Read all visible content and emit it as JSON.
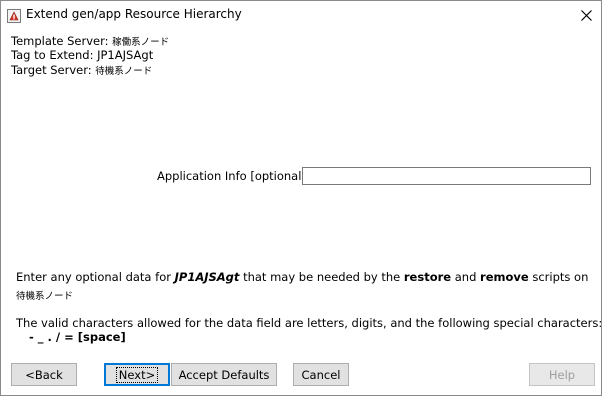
{
  "window": {
    "title": "Extend gen/app Resource Hierarchy",
    "close_glyph": "✕"
  },
  "info": {
    "template_label": "Template Server:",
    "template_value": "稼働系ノード",
    "tag_label": "Tag to Extend:",
    "tag_value": "JP1AJSAgt",
    "target_label": "Target Server:",
    "target_value": "待機系ノード"
  },
  "form": {
    "app_info_label": "Application Info [optional]",
    "app_info_value": ""
  },
  "message": {
    "part1": "Enter any optional data for ",
    "tag": "JP1AJSAgt",
    "part2": " that may be needed by the ",
    "restore": "restore",
    "and": " and ",
    "remove": "remove",
    "part3": " scripts on",
    "server": "待機系ノード",
    "valid_chars": "The valid characters allowed for the data field are letters, digits, and the following special characters:",
    "special_chars": "- _ . / = [space]"
  },
  "buttons": {
    "back": "<Back",
    "next": "Next>",
    "accept": "Accept Defaults",
    "cancel": "Cancel",
    "help": "Help"
  },
  "colors": {
    "focus_border": "#0078d7",
    "button_face": "#e1e1e1",
    "disabled_text": "#9e9e9e"
  }
}
